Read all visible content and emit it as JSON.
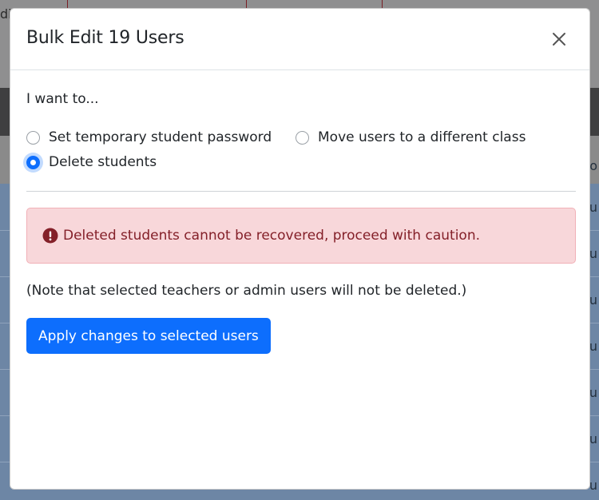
{
  "modal": {
    "title": "Bulk Edit 19 Users",
    "close_icon": "close-icon",
    "intro": "I want to...",
    "options": [
      {
        "label": "Set temporary student password",
        "checked": false
      },
      {
        "label": "Move users to a different class",
        "checked": false
      },
      {
        "label": "Delete students",
        "checked": true
      }
    ],
    "alert": {
      "icon": "exclamation-circle-icon",
      "text": "Deleted students cannot be recovered, proceed with caution."
    },
    "note": "(Note that selected teachers or admin users will not be deleted.)",
    "apply_label": "Apply changes to selected users"
  },
  "background": {
    "fragments": [
      "di",
      "o",
      "u",
      "u",
      "u",
      "u",
      "u",
      "u",
      "u"
    ]
  },
  "colors": {
    "primary": "#0d6efd",
    "danger_bg": "#f8d7da",
    "danger_text": "#842029",
    "backdrop_rows": "#6d86a5"
  }
}
